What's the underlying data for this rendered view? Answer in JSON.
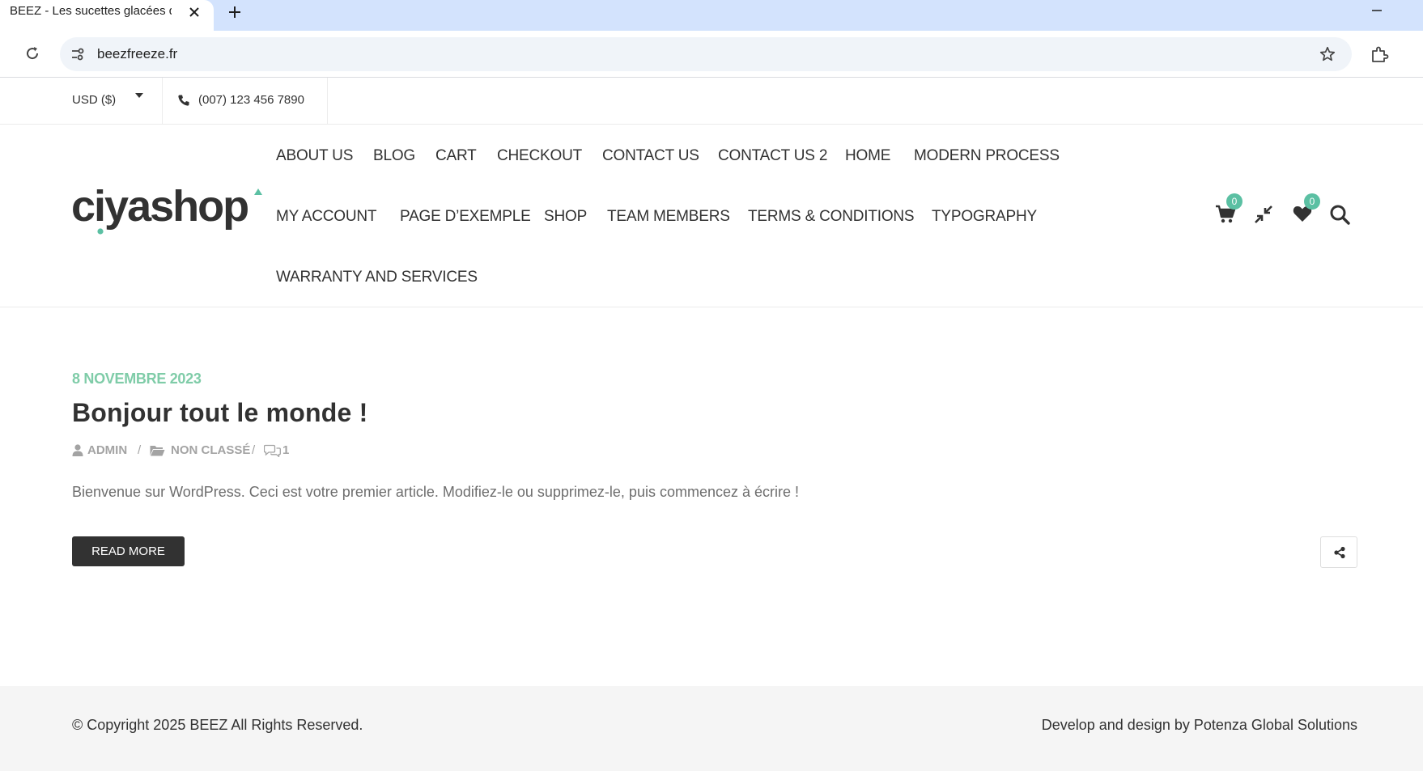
{
  "browser": {
    "tab_title": "BEEZ - Les sucettes glacées qui",
    "url": "beezfreeze.fr"
  },
  "topbar": {
    "currency": "USD ($)",
    "phone": "(007) 123 456 7890"
  },
  "nav": {
    "row1": [
      "ABOUT US",
      "BLOG",
      "CART",
      "CHECKOUT",
      "CONTACT US",
      "CONTACT US 2",
      "HOME",
      "MODERN PROCESS"
    ],
    "row2": [
      "MY ACCOUNT",
      "PAGE D’EXEMPLE",
      "SHOP",
      "TEAM MEMBERS",
      "TERMS & CONDITIONS",
      "TYPOGRAPHY"
    ],
    "row3": [
      "WARRANTY AND SERVICES"
    ]
  },
  "header_icons": {
    "cart_count": "0",
    "wishlist_count": "0",
    "accent_color": "#5bc0a3"
  },
  "post": {
    "date": "8 NOVEMBRE 2023",
    "title": "Bonjour tout le monde !",
    "author": "ADMIN",
    "category": "NON CLASSÉ",
    "comments": "1",
    "separator": "/",
    "excerpt": "Bienvenue sur WordPress. Ceci est votre premier article. Modifiez-le ou supprimez-le, puis commencez à écrire !",
    "read_more": "READ MORE"
  },
  "footer": {
    "copyright": "© Copyright 2025 BEEZ All Rights Reserved.",
    "credit": "Develop and design by Potenza Global Solutions"
  }
}
